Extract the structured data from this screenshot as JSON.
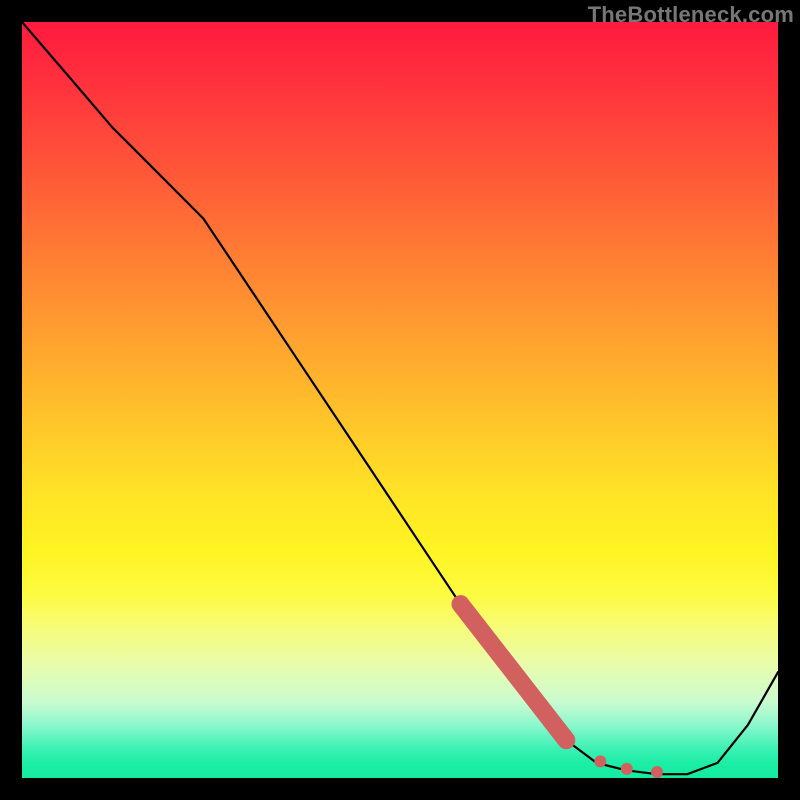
{
  "watermark": "TheBottleneck.com",
  "chart_data": {
    "type": "line",
    "title": "",
    "xlabel": "",
    "ylabel": "",
    "xlim": [
      0,
      100
    ],
    "ylim": [
      0,
      100
    ],
    "grid": false,
    "legend": false,
    "gradient_stops": [
      {
        "pct": 0,
        "color": "#ff1a3f"
      },
      {
        "pct": 7,
        "color": "#ff2e3d"
      },
      {
        "pct": 18,
        "color": "#ff5139"
      },
      {
        "pct": 30,
        "color": "#ff7a34"
      },
      {
        "pct": 42,
        "color": "#ffa22f"
      },
      {
        "pct": 54,
        "color": "#ffc92a"
      },
      {
        "pct": 63,
        "color": "#ffe526"
      },
      {
        "pct": 70,
        "color": "#fff423"
      },
      {
        "pct": 76,
        "color": "#fdfb44"
      },
      {
        "pct": 80,
        "color": "#f7fc77"
      },
      {
        "pct": 85,
        "color": "#e9fcac"
      },
      {
        "pct": 90,
        "color": "#c9fbd0"
      },
      {
        "pct": 93,
        "color": "#8bf7cd"
      },
      {
        "pct": 96,
        "color": "#3ff1b6"
      },
      {
        "pct": 98,
        "color": "#1ceea6"
      },
      {
        "pct": 100,
        "color": "#13eba0"
      }
    ],
    "series": [
      {
        "name": "curve",
        "color": "#000000",
        "x": [
          0,
          6,
          12,
          18,
          24,
          30,
          38,
          46,
          54,
          62,
          68,
          72,
          76,
          80,
          84,
          88,
          92,
          96,
          100
        ],
        "y": [
          100,
          93,
          86,
          80,
          74,
          65,
          53,
          41,
          29,
          17,
          9,
          5,
          2,
          1,
          0.5,
          0.5,
          2,
          7,
          14
        ]
      }
    ],
    "highlight_segment": {
      "name": "highlighted-range",
      "color": "#d1605e",
      "thick_stroke_width_px": 18,
      "thin_stroke_width_px": 8,
      "thick": {
        "x": [
          58,
          72
        ],
        "y": [
          23,
          5
        ]
      },
      "dots": [
        {
          "x": 72,
          "y": 5
        },
        {
          "x": 76.5,
          "y": 2.2
        },
        {
          "x": 80,
          "y": 1.2
        },
        {
          "x": 84,
          "y": 0.8
        }
      ],
      "dot_radius_px": 6
    }
  }
}
